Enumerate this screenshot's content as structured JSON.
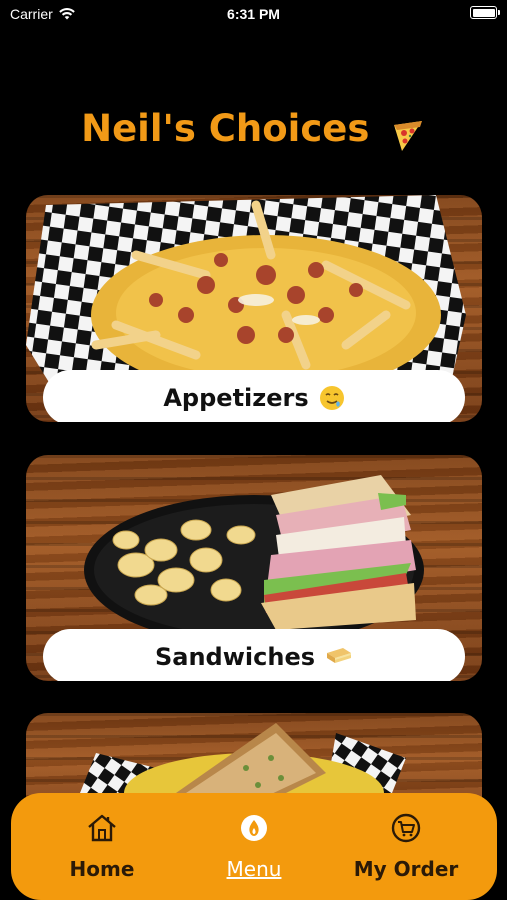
{
  "status_bar": {
    "carrier": "Carrier",
    "time": "6:31 PM"
  },
  "header": {
    "title": "Neil's Choices",
    "emoji_icon": "pizza-icon"
  },
  "categories": [
    {
      "label": "Appetizers",
      "emoji_icon": "drooling-face-icon",
      "image": "loaded fries in checkered paper basket"
    },
    {
      "label": "Sandwiches",
      "emoji_icon": "sandwich-icon",
      "image": "club sandwich with chips in black basket"
    },
    {
      "label": "",
      "emoji_icon": "",
      "image": "grilled sandwich in checkered basket"
    }
  ],
  "tab_bar": {
    "items": [
      {
        "label": "Home",
        "icon": "home-icon",
        "active": false
      },
      {
        "label": "Menu",
        "icon": "menu-icon",
        "active": true
      },
      {
        "label": "My Order",
        "icon": "cart-icon",
        "active": false
      }
    ]
  },
  "colors": {
    "accent": "#F29A17",
    "tab_bar": "#F39A0D",
    "background": "#000000"
  }
}
